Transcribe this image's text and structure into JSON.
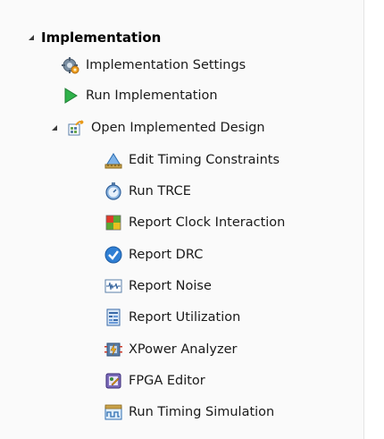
{
  "tree": {
    "root": {
      "label": "Implementation",
      "icon": "expanded-arrow-icon"
    },
    "items": [
      {
        "label": "Implementation Settings",
        "icon": "gear-settings-icon"
      },
      {
        "label": "Run Implementation",
        "icon": "play-run-icon"
      },
      {
        "label": "Open Implemented Design",
        "icon": "open-design-icon"
      },
      {
        "label": "Edit Timing Constraints",
        "icon": "timing-constraints-icon"
      },
      {
        "label": "Run TRCE",
        "icon": "stopwatch-icon"
      },
      {
        "label": "Report Clock Interaction",
        "icon": "clock-interaction-grid-icon"
      },
      {
        "label": "Report DRC",
        "icon": "check-circle-icon"
      },
      {
        "label": "Report Noise",
        "icon": "noise-waveform-icon"
      },
      {
        "label": "Report Utilization",
        "icon": "utilization-report-icon"
      },
      {
        "label": "XPower Analyzer",
        "icon": "xpower-analyzer-icon"
      },
      {
        "label": "FPGA Editor",
        "icon": "fpga-editor-icon"
      },
      {
        "label": "Run Timing Simulation",
        "icon": "timing-simulation-icon"
      }
    ]
  },
  "colors": {
    "accent_blue": "#2f7fd4",
    "run_green": "#2fb24a",
    "background": "#fafafa"
  }
}
